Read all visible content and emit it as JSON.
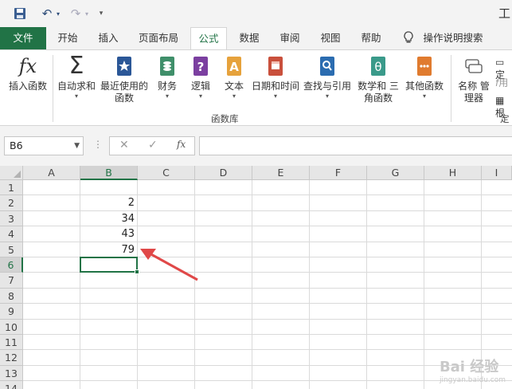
{
  "qat": {
    "undo_glyph": "↶",
    "redo_glyph": "↷",
    "title_fragment": "工"
  },
  "tabs": [
    {
      "label": "文件"
    },
    {
      "label": "开始"
    },
    {
      "label": "插入"
    },
    {
      "label": "页面布局"
    },
    {
      "label": "公式"
    },
    {
      "label": "数据"
    },
    {
      "label": "审阅"
    },
    {
      "label": "视图"
    },
    {
      "label": "帮助"
    },
    {
      "label": "操作说明搜索"
    }
  ],
  "ribbon": {
    "buttons": [
      {
        "label": "插入函数",
        "label2": ""
      },
      {
        "label": "自动求和",
        "label2": ""
      },
      {
        "label": "最近使用的",
        "label2": "函数"
      },
      {
        "label": "财务",
        "label2": ""
      },
      {
        "label": "逻辑",
        "label2": ""
      },
      {
        "label": "文本",
        "label2": ""
      },
      {
        "label": "日期和时间",
        "label2": ""
      },
      {
        "label": "查找与引用",
        "label2": ""
      },
      {
        "label": "数学和",
        "label2": "三角函数"
      },
      {
        "label": "其他函数",
        "label2": ""
      },
      {
        "label": "名称",
        "label2": "管理器"
      }
    ],
    "group_label": "函数库",
    "group_label_2": "定",
    "side_chars": [
      "定",
      "用",
      "根"
    ]
  },
  "formula_bar": {
    "namebox": "B6",
    "fx": "fx",
    "cancel": "✕",
    "enter": "✓",
    "value": ""
  },
  "grid": {
    "columns": [
      "A",
      "B",
      "C",
      "D",
      "E",
      "F",
      "G",
      "H",
      "I"
    ],
    "rows": [
      "1",
      "2",
      "3",
      "4",
      "5",
      "6",
      "7",
      "8",
      "9",
      "10",
      "11",
      "12",
      "13",
      "14"
    ],
    "cells": [
      {
        "ref": "B2",
        "value": "2"
      },
      {
        "ref": "B3",
        "value": "34"
      },
      {
        "ref": "B4",
        "value": "43"
      },
      {
        "ref": "B5",
        "value": "79"
      }
    ],
    "selected_cell": "B6"
  },
  "colors": {
    "accent": "#217346",
    "arrow": "#e04848"
  },
  "watermark": {
    "text": "Bai 经验",
    "sub": "jingyan.baidu.com"
  }
}
